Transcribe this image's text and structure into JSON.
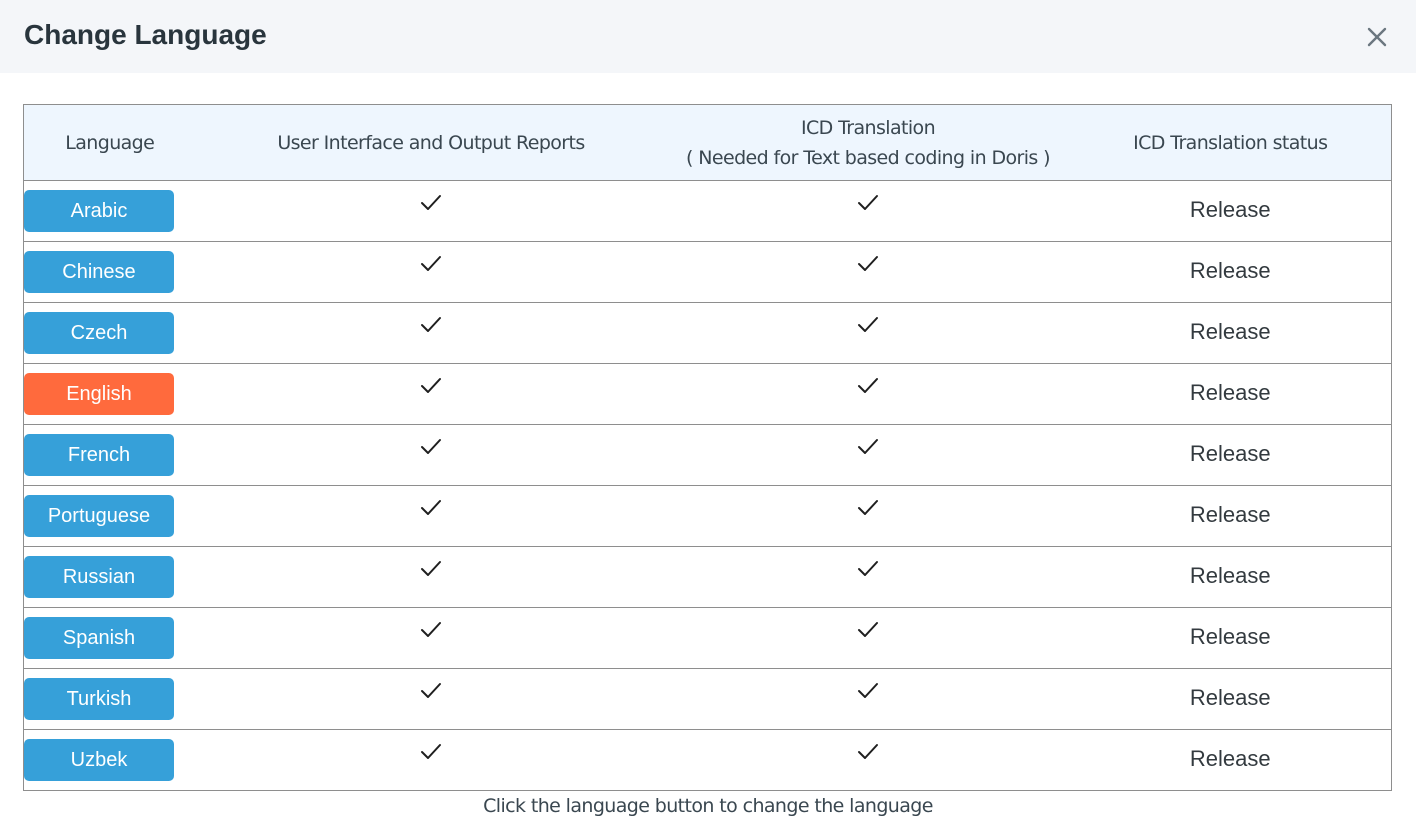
{
  "dialog": {
    "title": "Change Language",
    "close_icon": "close-icon"
  },
  "table": {
    "headers": {
      "language": "Language",
      "ui_reports": "User Interface and Output Reports",
      "icd_translation_line1": "ICD Translation",
      "icd_translation_line2": "( Needed for Text based coding in Doris )",
      "icd_status": "ICD Translation status"
    },
    "rows": [
      {
        "language": "Arabic",
        "ui_reports": "check",
        "icd_translation": "check",
        "status": "Release",
        "active": false
      },
      {
        "language": "Chinese",
        "ui_reports": "check",
        "icd_translation": "check",
        "status": "Release",
        "active": false
      },
      {
        "language": "Czech",
        "ui_reports": "check",
        "icd_translation": "check",
        "status": "Release",
        "active": false
      },
      {
        "language": "English",
        "ui_reports": "check",
        "icd_translation": "check",
        "status": "Release",
        "active": true
      },
      {
        "language": "French",
        "ui_reports": "check",
        "icd_translation": "check",
        "status": "Release",
        "active": false
      },
      {
        "language": "Portuguese",
        "ui_reports": "check",
        "icd_translation": "check",
        "status": "Release",
        "active": false
      },
      {
        "language": "Russian",
        "ui_reports": "check",
        "icd_translation": "check",
        "status": "Release",
        "active": false
      },
      {
        "language": "Spanish",
        "ui_reports": "check",
        "icd_translation": "check",
        "status": "Release",
        "active": false
      },
      {
        "language": "Turkish",
        "ui_reports": "check",
        "icd_translation": "check",
        "status": "Release",
        "active": false
      },
      {
        "language": "Uzbek",
        "ui_reports": "check",
        "icd_translation": "check",
        "status": "Release",
        "active": false
      }
    ]
  },
  "footer": {
    "hint": "Click the language button to change the language"
  },
  "colors": {
    "button": "#36a0d9",
    "button_active": "#ff6a3d",
    "header_bg": "#f4f6f9",
    "table_header_bg": "#eef6fe"
  }
}
